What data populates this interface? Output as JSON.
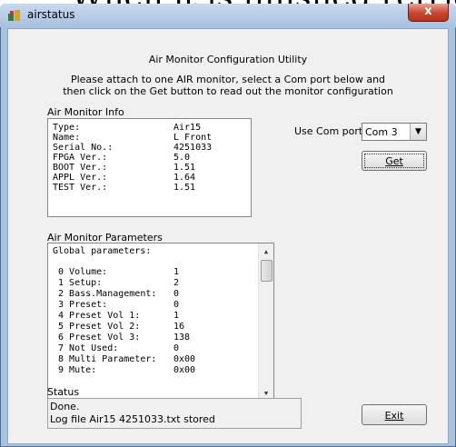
{
  "cut_heading": "When it is finished retrieving data it sh",
  "window": {
    "title": "airstatus",
    "close_glyph": "x"
  },
  "header": {
    "title": "Air Monitor Configuration Utility",
    "instructions_line1": "Please attach to one AIR monitor, select a Com port below and",
    "instructions_line2": "then click on the Get button to read out the monitor configuration"
  },
  "info": {
    "label": "Air Monitor Info",
    "rows": [
      {
        "key": "Type:",
        "value": "Air15"
      },
      {
        "key": "Name:",
        "value": "L Front"
      },
      {
        "key": "Serial No.:",
        "value": "4251033"
      },
      {
        "key": "FPGA Ver.:",
        "value": "5.0"
      },
      {
        "key": "BOOT Ver.:",
        "value": "1.51"
      },
      {
        "key": "APPL Ver.:",
        "value": "1.64"
      },
      {
        "key": "TEST Ver.:",
        "value": "1.51"
      }
    ]
  },
  "com": {
    "label": "Use Com port:",
    "selected": "Com 3",
    "arrow_glyph": "▼"
  },
  "get_button": {
    "label": "Get"
  },
  "params": {
    "label": "Air Monitor Parameters",
    "heading": "Global parameters:",
    "rows": [
      {
        "key": " 0 Volume:",
        "value": "1"
      },
      {
        "key": " 1 Setup:",
        "value": "2"
      },
      {
        "key": " 2 Bass.Management:",
        "value": "0"
      },
      {
        "key": " 3 Preset:",
        "value": "0"
      },
      {
        "key": " 4 Preset Vol 1:",
        "value": "1"
      },
      {
        "key": " 5 Preset Vol 2:",
        "value": "16"
      },
      {
        "key": " 6 Preset Vol 3:",
        "value": "138"
      },
      {
        "key": " 7 Not Used:",
        "value": "0"
      },
      {
        "key": " 8 Multi Parameter:",
        "value": "0x00"
      },
      {
        "key": " 9 Mute:",
        "value": "0x00"
      }
    ],
    "scroll_up": "▲",
    "scroll_down": "▼"
  },
  "status": {
    "label": "Status",
    "line1": "Done.",
    "line2": "Log file Air15 4251033.txt stored"
  },
  "exit_button": {
    "label": "Exit"
  }
}
